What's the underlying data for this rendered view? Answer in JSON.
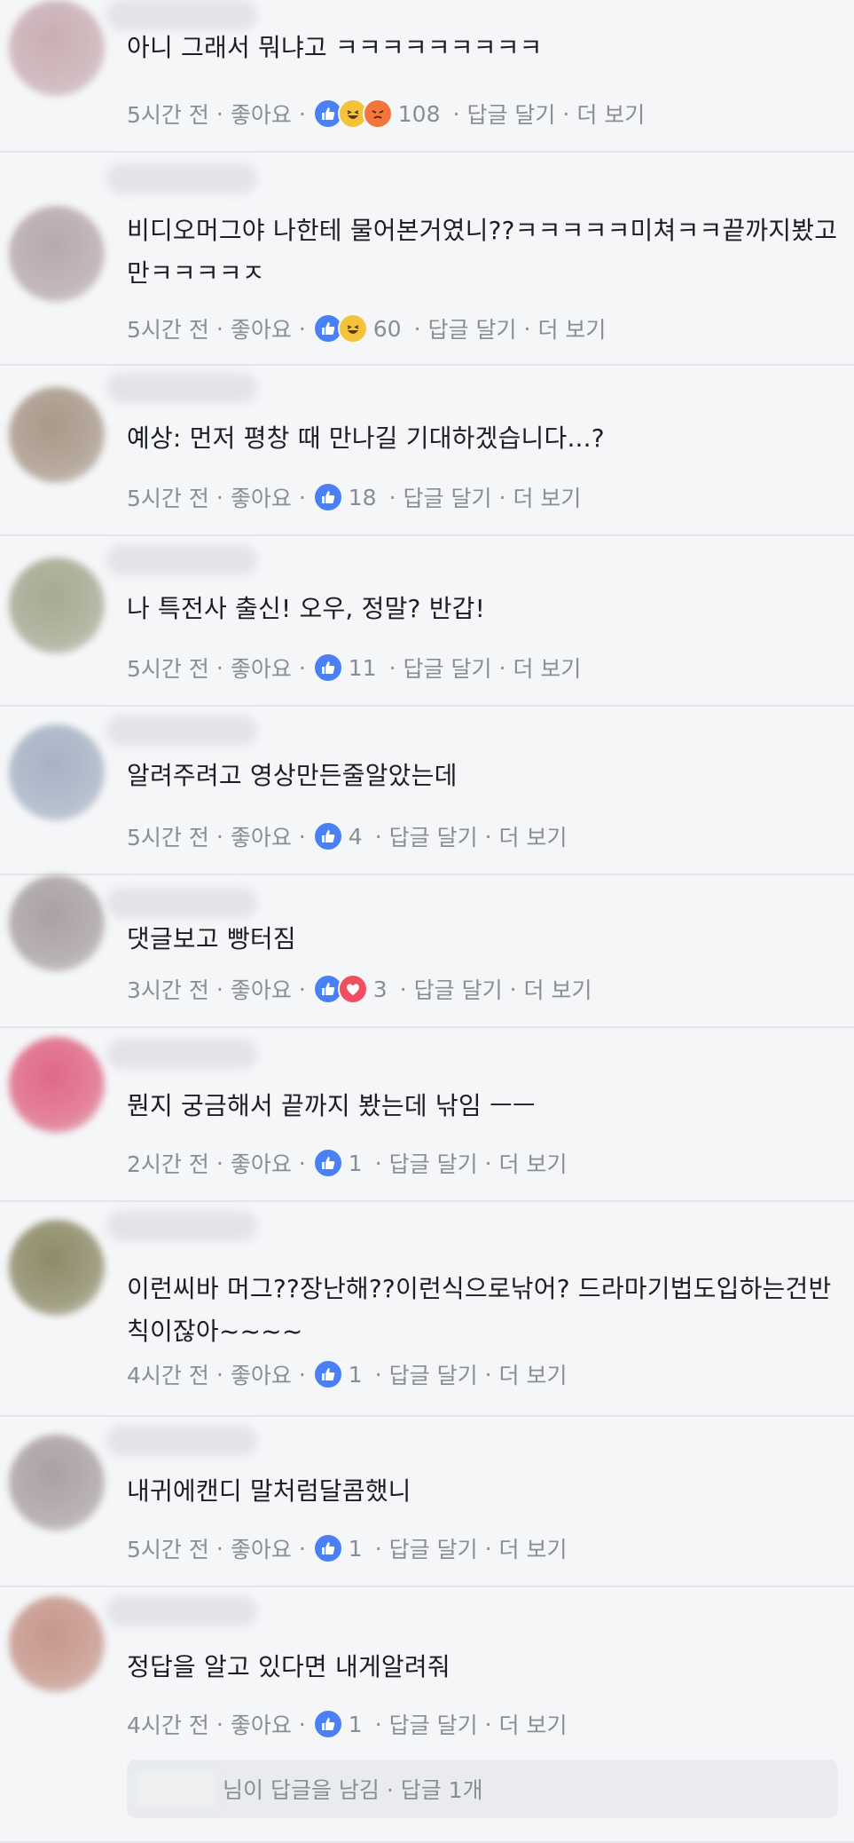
{
  "meta_labels": {
    "like": "좋아요",
    "reply": "답글 달기",
    "more": "더 보기",
    "dot": "·"
  },
  "comments": [
    {
      "text": "아니 그래서 뭐냐고 ㅋㅋㅋㅋㅋㅋㅋㅋㅋ",
      "time": "5시간 전",
      "reactions": [
        "like",
        "haha",
        "angry"
      ],
      "count": "108"
    },
    {
      "text": "비디오머그야 나한테 물어본거였니??ㅋㅋㅋㅋㅋ미쳐ㅋㅋ끝까지봤고만ㅋㅋㅋㅋㅈ",
      "time": "5시간 전",
      "reactions": [
        "like",
        "haha"
      ],
      "count": "60"
    },
    {
      "text": "예상: 먼저 평창 때 만나길 기대하겠습니다...?",
      "time": "5시간 전",
      "reactions": [
        "like"
      ],
      "count": "18"
    },
    {
      "text": "나 특전사 출신! 오우, 정말? 반갑!",
      "time": "5시간 전",
      "reactions": [
        "like"
      ],
      "count": "11"
    },
    {
      "text": "알려주려고 영상만든줄알았는데",
      "time": "5시간 전",
      "reactions": [
        "like"
      ],
      "count": "4"
    },
    {
      "text": "댓글보고 빵터짐",
      "time": "3시간 전",
      "reactions": [
        "like",
        "love"
      ],
      "count": "3"
    },
    {
      "text": "뭔지 궁금해서 끝까지 봤는데 낚임 ㅡㅡ",
      "time": "2시간 전",
      "reactions": [
        "like"
      ],
      "count": "1"
    },
    {
      "text": "이런씨바 머그??장난해??이런식으로낚어? 드라마기법도입하는건반칙이잖아~~~~",
      "time": "4시간 전",
      "reactions": [
        "like"
      ],
      "count": "1"
    },
    {
      "text": "내귀에캔디 말처럼달콤했니",
      "time": "5시간 전",
      "reactions": [
        "like"
      ],
      "count": "1"
    },
    {
      "text": "정답을 알고 있다면 내게알려줘",
      "time": "4시간 전",
      "reactions": [
        "like"
      ],
      "count": "1",
      "reply_summary": "님이 답글을 남김 · 답글 1개"
    }
  ],
  "colors": {
    "like": "#4a80f5",
    "haha": "#f5c33b",
    "angry": "#f2763c",
    "love": "#f04f61",
    "meta_gray": "#8a8d91"
  }
}
